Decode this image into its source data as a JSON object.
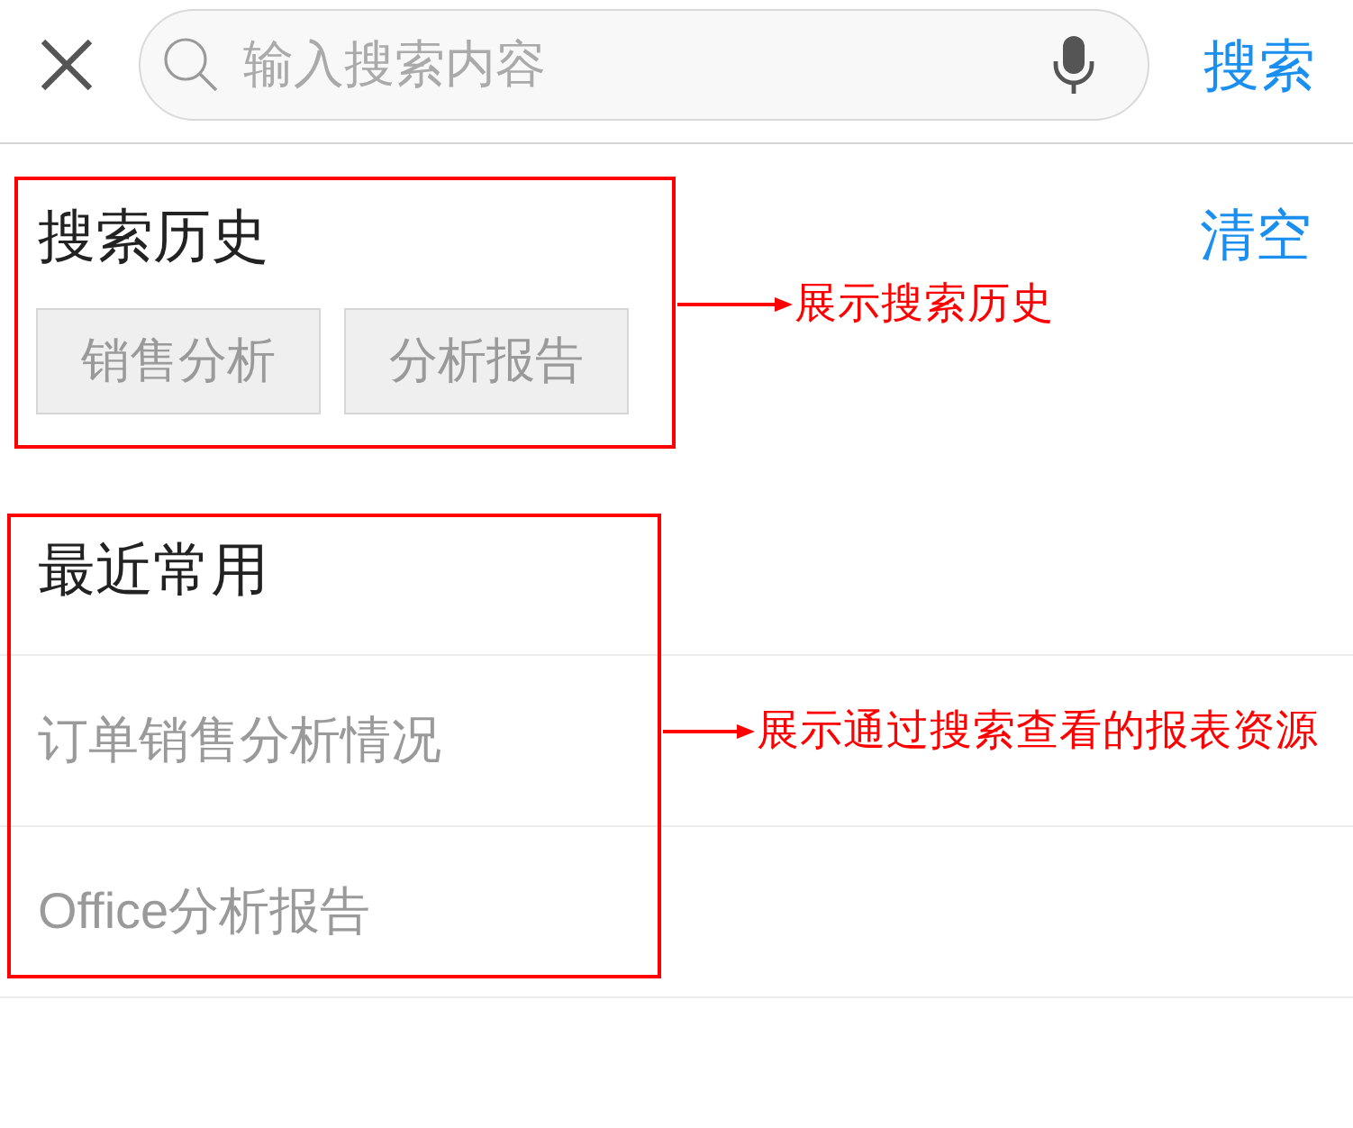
{
  "header": {
    "search": {
      "placeholder": "输入搜索内容"
    },
    "search_button": "搜索"
  },
  "history": {
    "title": "搜索历史",
    "clear_button": "清空",
    "tags": [
      "销售分析",
      "分析报告"
    ]
  },
  "recent": {
    "title": "最近常用",
    "items": [
      "订单销售分析情况",
      "Office分析报告"
    ]
  },
  "annotations": [
    {
      "text": "展示搜索历史"
    },
    {
      "text": "展示通过搜索查看的报表资源"
    }
  ]
}
